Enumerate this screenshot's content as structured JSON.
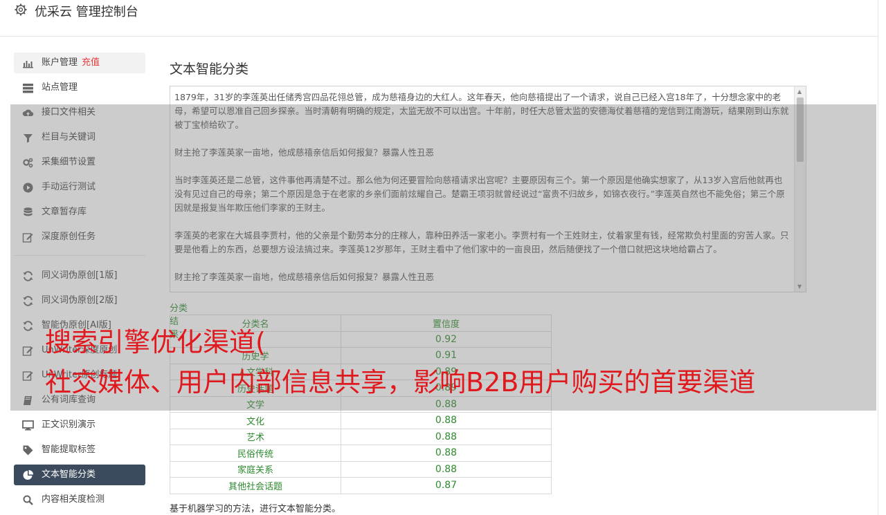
{
  "header": {
    "title": "优采云 管理控制台",
    "icon": "gear-icon"
  },
  "sidebar": {
    "items": [
      {
        "label": "账户管理",
        "tag": "充值",
        "icon": "bar-chart-icon"
      },
      {
        "label": "站点管理",
        "icon": "server-icon"
      },
      {
        "label": "接口文件相关",
        "icon": "cloud-upload-icon"
      },
      {
        "label": "栏目与关键词",
        "icon": "filter-icon"
      },
      {
        "label": "采集细节设置",
        "icon": "gears-icon"
      },
      {
        "label": "手动运行测试",
        "icon": "play-circle-icon"
      },
      {
        "label": "文章暂存库",
        "icon": "database-icon"
      },
      {
        "label": "深度原创任务",
        "icon": "edit-icon"
      },
      {
        "label": "同义词伪原创[1版]",
        "icon": "refresh-icon"
      },
      {
        "label": "同义词伪原创[2版]",
        "icon": "refresh-icon"
      },
      {
        "label": "智能伪原创[AI版]",
        "icon": "refresh-icon"
      },
      {
        "label": "UnWriter深度原创",
        "icon": "edit-icon"
      },
      {
        "label": "UnWriter原创标题",
        "icon": "edit-icon"
      },
      {
        "label": "公有词库查询",
        "icon": "book-icon"
      },
      {
        "label": "正文识别演示",
        "icon": "monitor-icon"
      },
      {
        "label": "智能提取标签",
        "icon": "tag-icon"
      },
      {
        "label": "文本智能分类",
        "icon": "pie-chart-icon",
        "active": true
      },
      {
        "label": "内容相关度检测",
        "icon": "search-icon"
      }
    ]
  },
  "main": {
    "title": "文本智能分类",
    "text_paragraphs": [
      "1879年，31岁的李莲英出任储秀宫四品花翎总管，成为慈禧身边的大红人。这年春天，他向慈禧提出了一个请求，说自己已经入宫18年了，十分想念家中的老母，希望可以恩准自己回乡探亲。当时清朝有明确的规定，太监无故不可以出宫。十年前，时任大总管太监的安德海仗着慈禧的宠信到江南游玩，结果刚到山东就被丁宝桢给砍了。",
      "财主抢了李莲英家一亩地，他成慈禧亲信后如何报复？暴露人性丑恶",
      "当时李莲英还是二总管，这件事他再清楚不过。那么他为何还要冒险向慈禧请求出宫呢？主要原因有三个。第一个原因是他确实想家了，从13岁入宫后他就再也没有见过自己的母亲；第二个原因是急于在老家的乡亲们面前炫耀自己。楚霸王项羽就曾经说过“富贵不归故乡，如锦衣夜行。”李莲英自然也不能免俗；第三个原因就是报复当年欺压他们李家的王财主。",
      "李莲英的老家在大城县李贾村，他的父亲是个勤劳本分的庄稼人，靠种田养活一家老小。李贾村有一个王姓财主，仗着家里有钱，经常欺负村里面的穷苦人家。只要是他看上的东西，总要想方设法搞过来。李莲英12岁那年，王财主看中了他们家中的一亩良田，然后随便找了一个借口就把这块地给霸占了。",
      "财主抢了李莲英家一亩地，他成慈禧亲信后如何报复？暴露人性丑恶"
    ],
    "result_label": "分类结果：",
    "table": {
      "headers": [
        "分类名",
        "置信度"
      ],
      "rows": [
        [
          "",
          "0.92"
        ],
        [
          "历史学",
          "0.91"
        ],
        [
          "人文学科",
          "0.89"
        ],
        [
          "历史话题",
          "0.89"
        ],
        [
          "文学",
          "0.88"
        ],
        [
          "文化",
          "0.88"
        ],
        [
          "艺术",
          "0.88"
        ],
        [
          "民俗传统",
          "0.88"
        ],
        [
          "家庭关系",
          "0.88"
        ],
        [
          "其他社会话题",
          "0.87"
        ]
      ]
    },
    "footer_note": "基于机器学习的方法，进行文本智能分类。"
  },
  "overlay": {
    "line1": "搜索引擎优化渠道(",
    "line2": "社交媒体、用户内部信息共享，影响B2B用户购买的首要渠道"
  },
  "colors": {
    "accent_green": "#2e8b2e",
    "active_bg": "#3b4a5c",
    "tag_red": "#e4393c",
    "overlay_red": "#e0191f"
  }
}
